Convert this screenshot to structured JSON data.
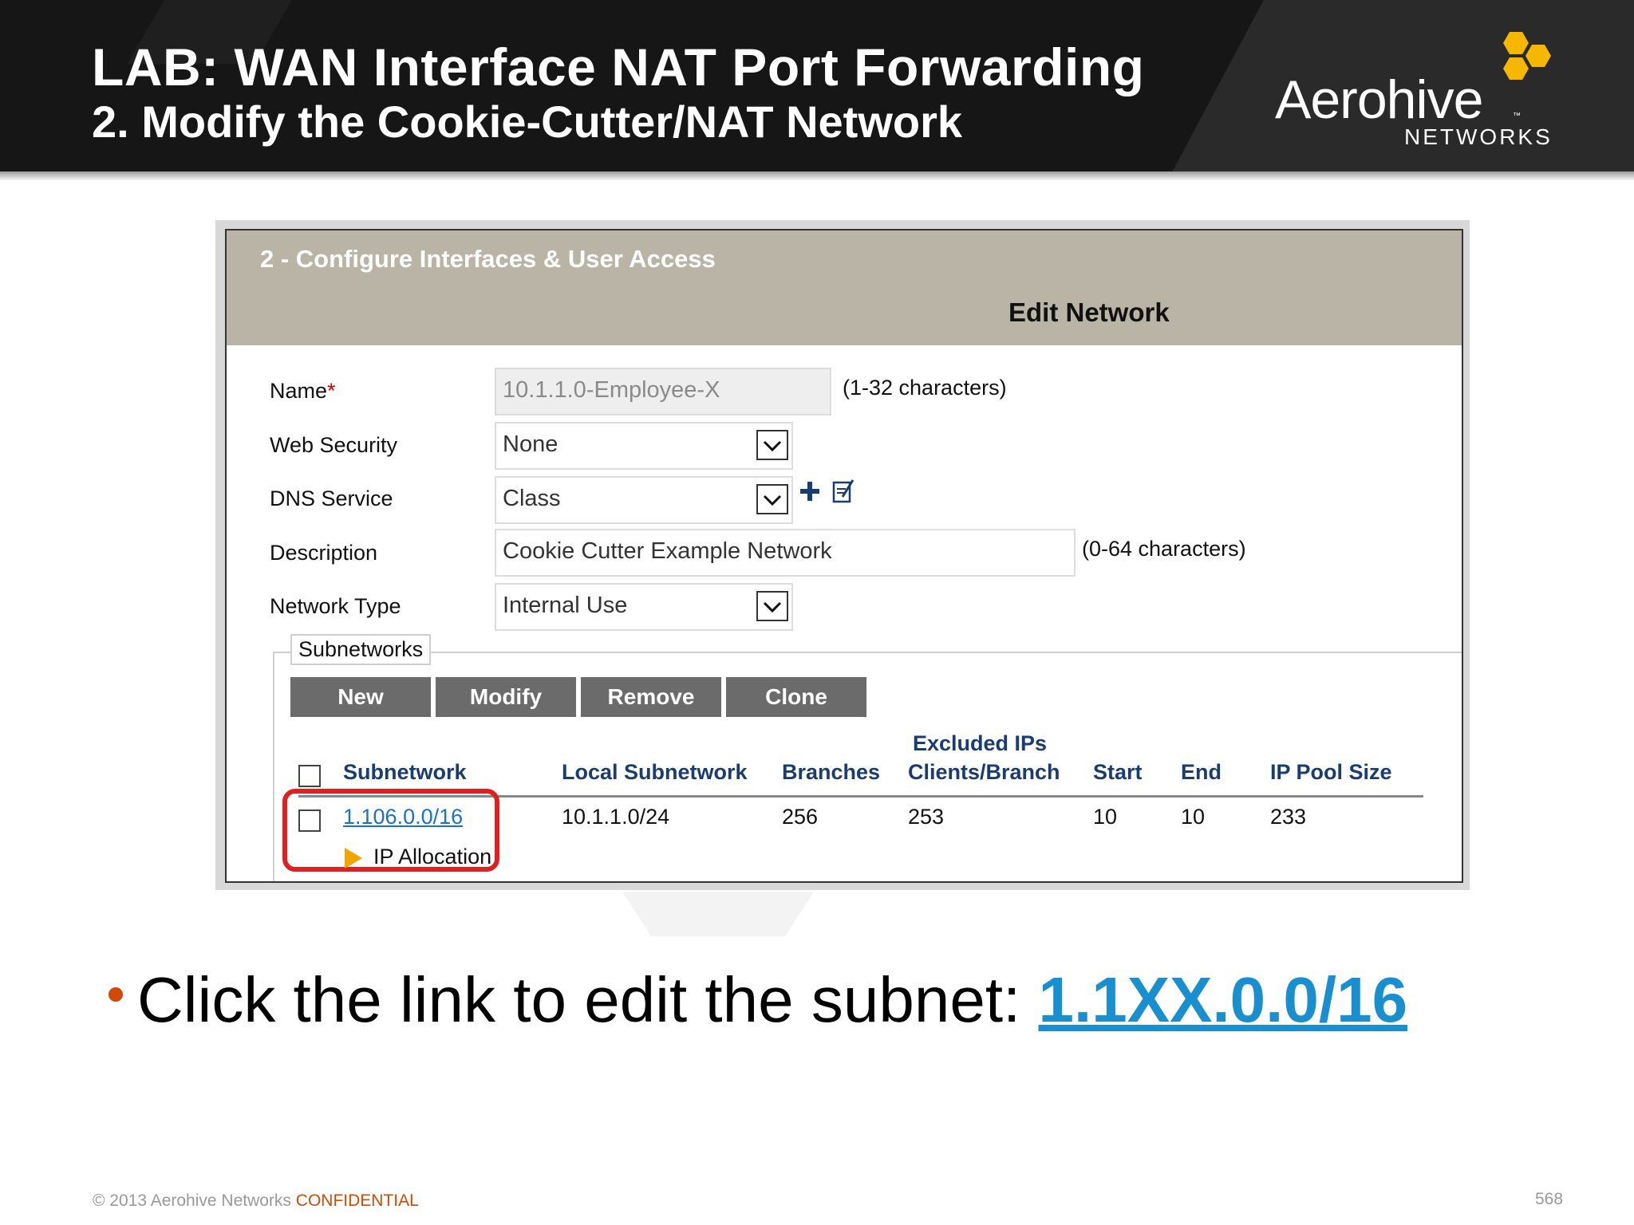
{
  "slide": {
    "title": "LAB: WAN Interface NAT Port Forwarding",
    "subtitle": "2. Modify the Cookie-Cutter/NAT Network",
    "logo": {
      "word": "Aerohive",
      "tm": "™",
      "sub": "NETWORKS"
    }
  },
  "app": {
    "section_title": "2 - Configure Interfaces & User Access",
    "page_title": "Edit Network",
    "form": {
      "name_label": "Name",
      "name_required": "*",
      "name_value": "10.1.1.0-Employee-X",
      "name_hint": "(1-32 characters)",
      "web_security_label": "Web Security",
      "web_security_value": "None",
      "dns_service_label": "DNS Service",
      "dns_service_value": "Class",
      "description_label": "Description",
      "description_value": "Cookie Cutter Example Network",
      "description_hint": "(0-64 characters)",
      "network_type_label": "Network Type",
      "network_type_value": "Internal Use"
    },
    "subnetworks": {
      "legend": "Subnetworks",
      "buttons": {
        "new": "New",
        "modify": "Modify",
        "remove": "Remove",
        "clone": "Clone"
      },
      "columns": {
        "subnetwork": "Subnetwork",
        "local_subnetwork": "Local Subnetwork",
        "branches": "Branches",
        "excluded_line1": "Excluded IPs",
        "excluded_line2": "Clients/Branch",
        "start": "Start",
        "end": "End",
        "ip_pool_size": "IP Pool Size"
      },
      "rows": [
        {
          "subnetwork": "1.106.0.0/16",
          "local_subnetwork": "10.1.1.0/24",
          "branches": "256",
          "excluded": "253",
          "start": "10",
          "end": "10",
          "ip_pool_size": "233"
        }
      ],
      "ip_allocation": "IP Allocation"
    }
  },
  "bullet": {
    "text": "Click the link to edit the subnet: ",
    "link": "1.1XX.0.0/16"
  },
  "footer": {
    "copyright": "© 2013 Aerohive Networks ",
    "confidential": "CONFIDENTIAL",
    "page_number": "568"
  },
  "colors": {
    "header_bg": "#161616",
    "band_bg": "#b9b4a6",
    "button_bg": "#6b6b6b",
    "link": "#1a6fd0",
    "highlight": "#e02020",
    "accent": "#d04a02",
    "logo_gold": "#f5b700"
  }
}
